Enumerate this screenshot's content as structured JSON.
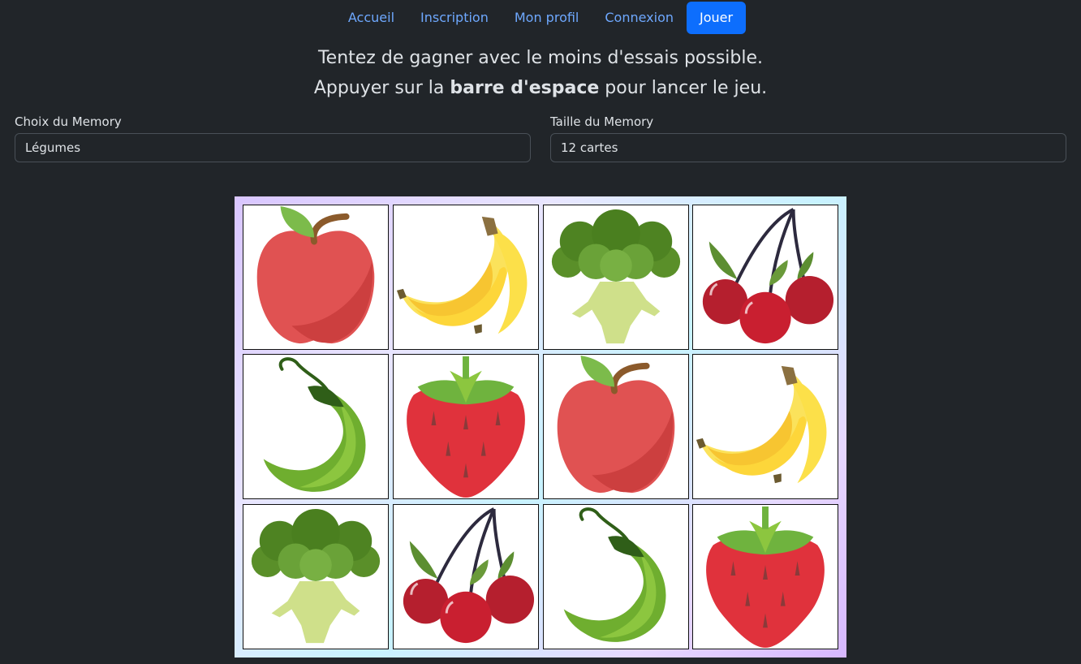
{
  "nav": {
    "items": [
      {
        "label": "Accueil"
      },
      {
        "label": "Inscription"
      },
      {
        "label": "Mon profil"
      },
      {
        "label": "Connexion"
      },
      {
        "label": "Jouer"
      }
    ]
  },
  "intro": {
    "line1": "Tentez de gagner avec le moins d'essais possible.",
    "line2_prefix": "Appuyer sur la ",
    "line2_bold": "barre d'espace",
    "line2_suffix": " pour lancer le jeu."
  },
  "controls": {
    "memory_choice": {
      "label": "Choix du Memory",
      "value": "Légumes"
    },
    "memory_size": {
      "label": "Taille du Memory",
      "value": "12 cartes"
    }
  },
  "board": {
    "cards": [
      {
        "icon": "apple-icon"
      },
      {
        "icon": "banana-icon"
      },
      {
        "icon": "broccoli-icon"
      },
      {
        "icon": "cherry-icon"
      },
      {
        "icon": "chili-pepper-icon"
      },
      {
        "icon": "strawberry-icon"
      },
      {
        "icon": "apple-icon"
      },
      {
        "icon": "banana-icon"
      },
      {
        "icon": "broccoli-icon"
      },
      {
        "icon": "cherry-icon"
      },
      {
        "icon": "chili-pepper-icon"
      },
      {
        "icon": "strawberry-icon"
      }
    ]
  },
  "colors": {
    "background": "#212529",
    "link": "#6ea8fe",
    "active": "#0d6efd"
  }
}
